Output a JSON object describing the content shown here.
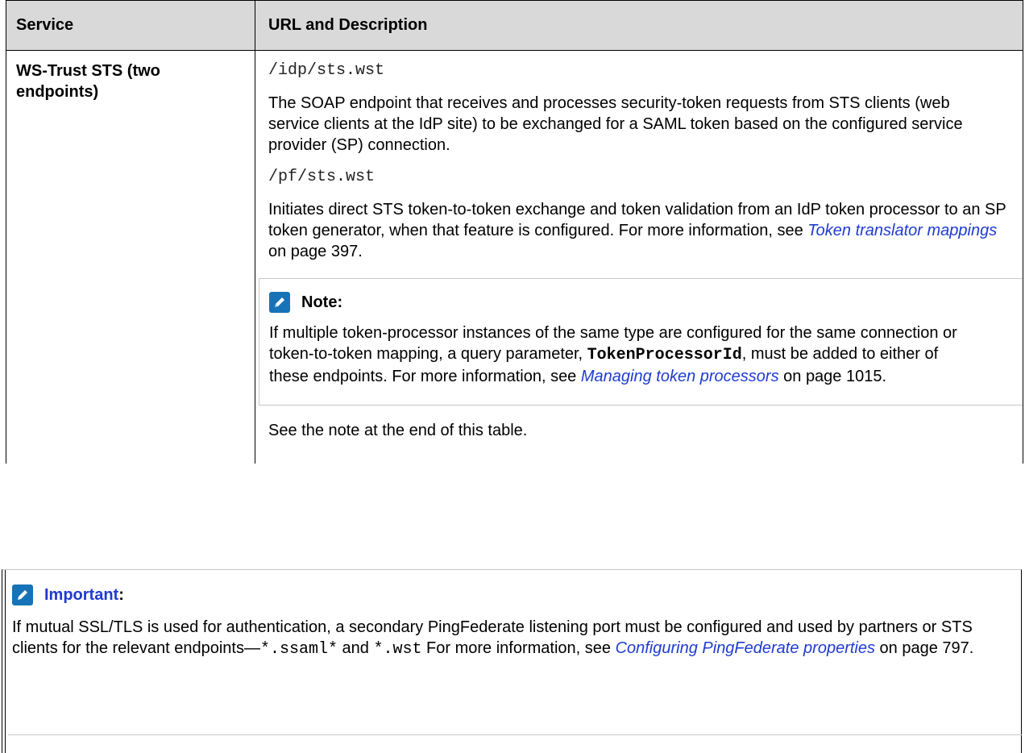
{
  "table": {
    "headers": {
      "service": "Service",
      "url_desc": "URL and Description"
    },
    "row": {
      "service": "WS-Trust STS (two endpoints)",
      "endpoint1": "/idp/sts.wst",
      "desc1": "The SOAP endpoint that receives and processes security-token requests from STS clients (web service clients at the IdP site) to be exchanged for a SAML token based on the configured service provider (SP) connection.",
      "endpoint2": "/pf/sts.wst",
      "desc2_pre": "Initiates direct STS token-to-token exchange and token validation from an IdP token processor to an SP token generator, when that feature is configured. For more information, see ",
      "desc2_link": "Token translator mappings",
      "desc2_post": " on page 397.",
      "note": {
        "icon": "pencil-icon",
        "title": "Note:",
        "text_pre": "If multiple token-processor instances of the same type are configured for the same connection or token-to-token mapping, a query parameter, ",
        "param": "TokenProcessorId",
        "text_mid": ", must be added to either of these endpoints. For more information, see ",
        "link": "Managing token processors",
        "text_post": " on page 1015."
      },
      "see_note": "See the note at the end of this table."
    }
  },
  "important": {
    "icon": "pencil-icon",
    "title": "Important",
    "colon": ":",
    "text_pre": "If mutual SSL/TLS is used for authentication, a secondary PingFederate listening port must be configured and used by partners or STS clients for the relevant endpoints—",
    "code1": "*.ssaml*",
    "text_and": " and ",
    "code2": "*.wst",
    "text_mid": " For more information, see ",
    "link": "Configuring PingFederate properties",
    "text_post": " on page 797."
  },
  "colors": {
    "header_bg": "#d9d9d9",
    "link": "#1f3bd1",
    "icon_bg": "#1673b8"
  }
}
